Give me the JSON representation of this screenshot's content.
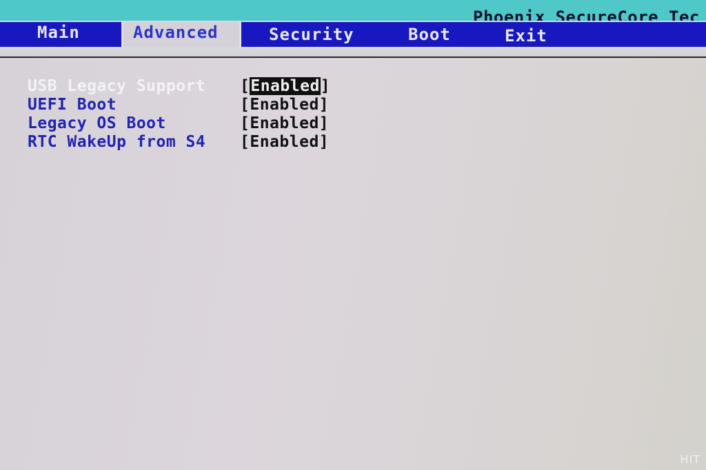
{
  "header": {
    "title": "Phoenix SecureCore Tec"
  },
  "menu": {
    "tabs": [
      {
        "label": "Main",
        "active": false
      },
      {
        "label": "Advanced",
        "active": true
      },
      {
        "label": "Security",
        "active": false
      },
      {
        "label": "Boot",
        "active": false
      },
      {
        "label": "Exit",
        "active": false
      }
    ]
  },
  "settings": [
    {
      "label": "USB Legacy Support",
      "value": "Enabled",
      "selected": true
    },
    {
      "label": "UEFI Boot",
      "value": "Enabled",
      "selected": false
    },
    {
      "label": "Legacy OS Boot",
      "value": "Enabled",
      "selected": false
    },
    {
      "label": "RTC WakeUp from S4",
      "value": "Enabled",
      "selected": false
    }
  ],
  "watermark": "HIT",
  "colors": {
    "title_bar": "#4ec8c8",
    "menu_bar": "#1818c0",
    "background": "#d8d4d8",
    "label_text": "#2222b4",
    "highlight_text": "#f4f2f6",
    "value_highlight_bg": "#101010"
  }
}
